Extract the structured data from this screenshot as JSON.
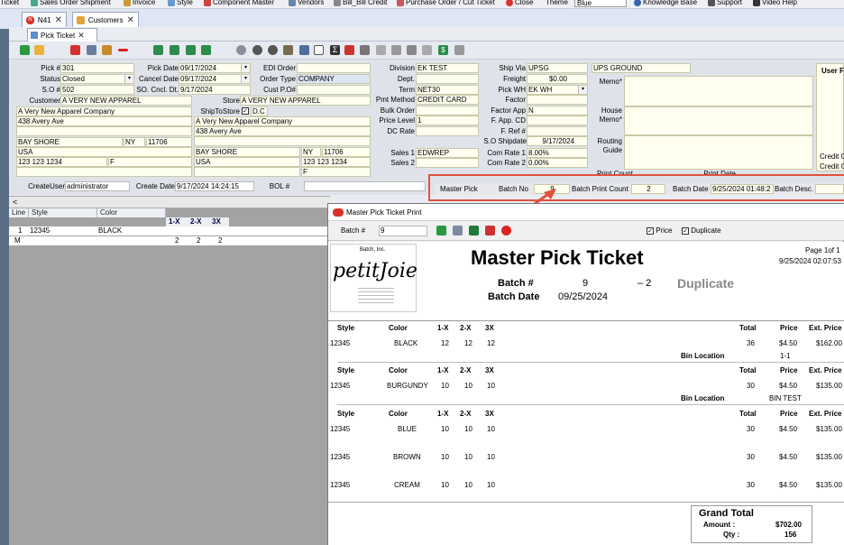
{
  "menu": [
    "Ticket",
    "Sales Order Shipment",
    "Invoice",
    "Style",
    "Component Master",
    "Vendors",
    "Bill_Bill Credit",
    "Purchase Order / Cut Ticket",
    "Close",
    "Theme",
    "Blue",
    "Knowledge Base",
    "Support",
    "Video Help"
  ],
  "tabs": [
    {
      "label": "N41"
    },
    {
      "label": "Customers"
    }
  ],
  "inner_tab": "Pick Ticket",
  "form": {
    "pick_no_label": "Pick #",
    "pick_no": "301",
    "pick_date_label": "Pick Date",
    "pick_date": "09/17/2024",
    "edi_order_label": "EDI Order",
    "edi_order": "",
    "status_label": "Status",
    "status": "Closed",
    "cancel_date_label": "Cancel Date",
    "cancel_date": "09/17/2024",
    "order_type_label": "Order Type",
    "order_type": "COMPANY",
    "so_no_label": "S.O #",
    "so_no": "502",
    "so_cncl_label": "SO. Cncl. Dt.",
    "so_cncl": "9/17/2024",
    "cust_po_label": "Cust P.O#",
    "cust_po": "",
    "customer_label": "Customer",
    "customer": "A VERY NEW APPAREL",
    "store_label": "Store",
    "store": "A VERY NEW APPAREL",
    "bill_name": "A Very New Apparel Company",
    "bill_addr": "438 Avery Ave",
    "bill_city": "BAY SHORE",
    "bill_state": "NY",
    "bill_zip": "11706",
    "bill_country": "USA",
    "bill_phone": "123 123 1234",
    "bill_f": "F",
    "shiptostore_label": "ShipToStore",
    "shiptostore_dc": "D.C",
    "ship_name": "A Very New Apparel Company",
    "ship_addr": "438 Avery Ave",
    "ship_city": "BAY SHORE",
    "ship_state": "NY",
    "ship_zip": "11706",
    "ship_country": "USA",
    "ship_phone": "123 123 1234",
    "ship_f": "F",
    "division_label": "Division",
    "division": "EK TEST",
    "dept_label": "Dept.",
    "dept": "",
    "term_label": "Term",
    "term": "NET30",
    "pmt_label": "Pmt Method",
    "pmt": "CREDIT CARD",
    "bulk_label": "Bulk Order",
    "bulk": "",
    "price_level_label": "Price Level",
    "price_level": "1",
    "dc_rate_label": "DC Rate",
    "dc_rate": "",
    "sales1_label": "Sales 1",
    "sales1": "EDWREP",
    "sales2_label": "Sales 2",
    "sales2": "",
    "ship_via_label": "Ship Via",
    "ship_via": "UPSG",
    "ship_via_desc": "UPS GROUND",
    "freight_label": "Freight",
    "freight": "$0.00",
    "pick_wh_label": "Pick WH",
    "pick_wh": "EK WH",
    "factor_label": "Factor",
    "factor": "",
    "factor_app_label": "Factor App",
    "factor_app": "N",
    "f_app_cd_label": "F. App. CD",
    "f_app_cd": "",
    "f_ref_label": "F. Ref #",
    "f_ref": "",
    "so_shipdate_label": "S.O Shipdate",
    "so_shipdate": "9/17/2024",
    "com_rate1_label": "Com Rate 1",
    "com_rate1": "8.00%",
    "com_rate2_label": "Com Rate 2",
    "com_rate2": "0.00%",
    "memo_label": "Memo*",
    "house_memo_label": "House Memo*",
    "routing_guide_label": "Routing Guide",
    "user_label": "User F",
    "credit1": "Credit C",
    "credit2": "Credit C",
    "create_user_label": "CreateUser",
    "create_user": "administrator",
    "create_date_label": "Create Date",
    "create_date": "9/17/2024 14:24:15",
    "bol_label": "BOL #",
    "bol": "",
    "print_count_label": "Print Count",
    "print_date_label": "Print Date"
  },
  "master_pick": {
    "label": "Master Pick",
    "batch_no_label": "Batch No",
    "batch_no": "9",
    "batch_print_count_label": "Batch Print Count",
    "batch_print_count": "2",
    "batch_date_label": "Batch Date",
    "batch_date": "9/25/2024 01:48:2",
    "batch_desc_label": "Batch Desc."
  },
  "grid": {
    "headers": [
      "Line",
      "Style",
      "Color",
      "1-X",
      "2-X",
      "3X"
    ],
    "row": {
      "line": "1",
      "style": "12345",
      "color": "BLACK"
    },
    "m_row": {
      "line": "M",
      "q1": "2",
      "q2": "2",
      "q3": "2"
    }
  },
  "popup": {
    "title": "Master Pick Ticket Print",
    "batch_label": "Batch #",
    "batch_value": "9",
    "price_label": "Price",
    "duplicate_label": "Duplicate"
  },
  "report": {
    "logo_top": "Batch, Inc.",
    "logo_brand": "petitJoie",
    "title": "Master Pick Ticket",
    "page": "Page 1of 1",
    "datetime": "9/25/2024 02:07:53",
    "batch_label": "Batch #",
    "batch_value": "9",
    "dash_value": "– 2",
    "duplicate": "Duplicate",
    "batch_date_label": "Batch Date",
    "batch_date_value": "09/25/2024",
    "headers": {
      "style": "Style",
      "color": "Color",
      "q1": "1-X",
      "q2": "2-X",
      "q3": "3X",
      "total": "Total",
      "price": "Price",
      "ext": "Ext. Price"
    },
    "sections": [
      {
        "rows": [
          {
            "style": "12345",
            "color": "BLACK",
            "q1": "12",
            "q2": "12",
            "q3": "12",
            "total": "36",
            "price": "$4.50",
            "ext": "$162.00"
          }
        ],
        "bin_label": "Bin Location",
        "bin": "1-1"
      },
      {
        "rows": [
          {
            "style": "12345",
            "color": "BURGUNDY",
            "q1": "10",
            "q2": "10",
            "q3": "10",
            "total": "30",
            "price": "$4.50",
            "ext": "$135.00"
          }
        ],
        "bin_label": "Bin Location",
        "bin": "BIN TEST"
      },
      {
        "rows": [
          {
            "style": "12345",
            "color": "BLUE",
            "q1": "10",
            "q2": "10",
            "q3": "10",
            "total": "30",
            "price": "$4.50",
            "ext": "$135.00"
          },
          {
            "style": "12345",
            "color": "BROWN",
            "q1": "10",
            "q2": "10",
            "q3": "10",
            "total": "30",
            "price": "$4.50",
            "ext": "$135.00"
          },
          {
            "style": "12345",
            "color": "CREAM",
            "q1": "10",
            "q2": "10",
            "q3": "10",
            "total": "30",
            "price": "$4.50",
            "ext": "$135.00"
          }
        ]
      }
    ],
    "grand_total_label": "Grand Total",
    "amount_label": "Amount :",
    "amount": "$702.00",
    "qty_label": "Qty :",
    "qty": "156"
  },
  "colors": {
    "accent_red": "#e0513c",
    "field_bg": "#fffff0",
    "workspace": "#5b6e86"
  }
}
